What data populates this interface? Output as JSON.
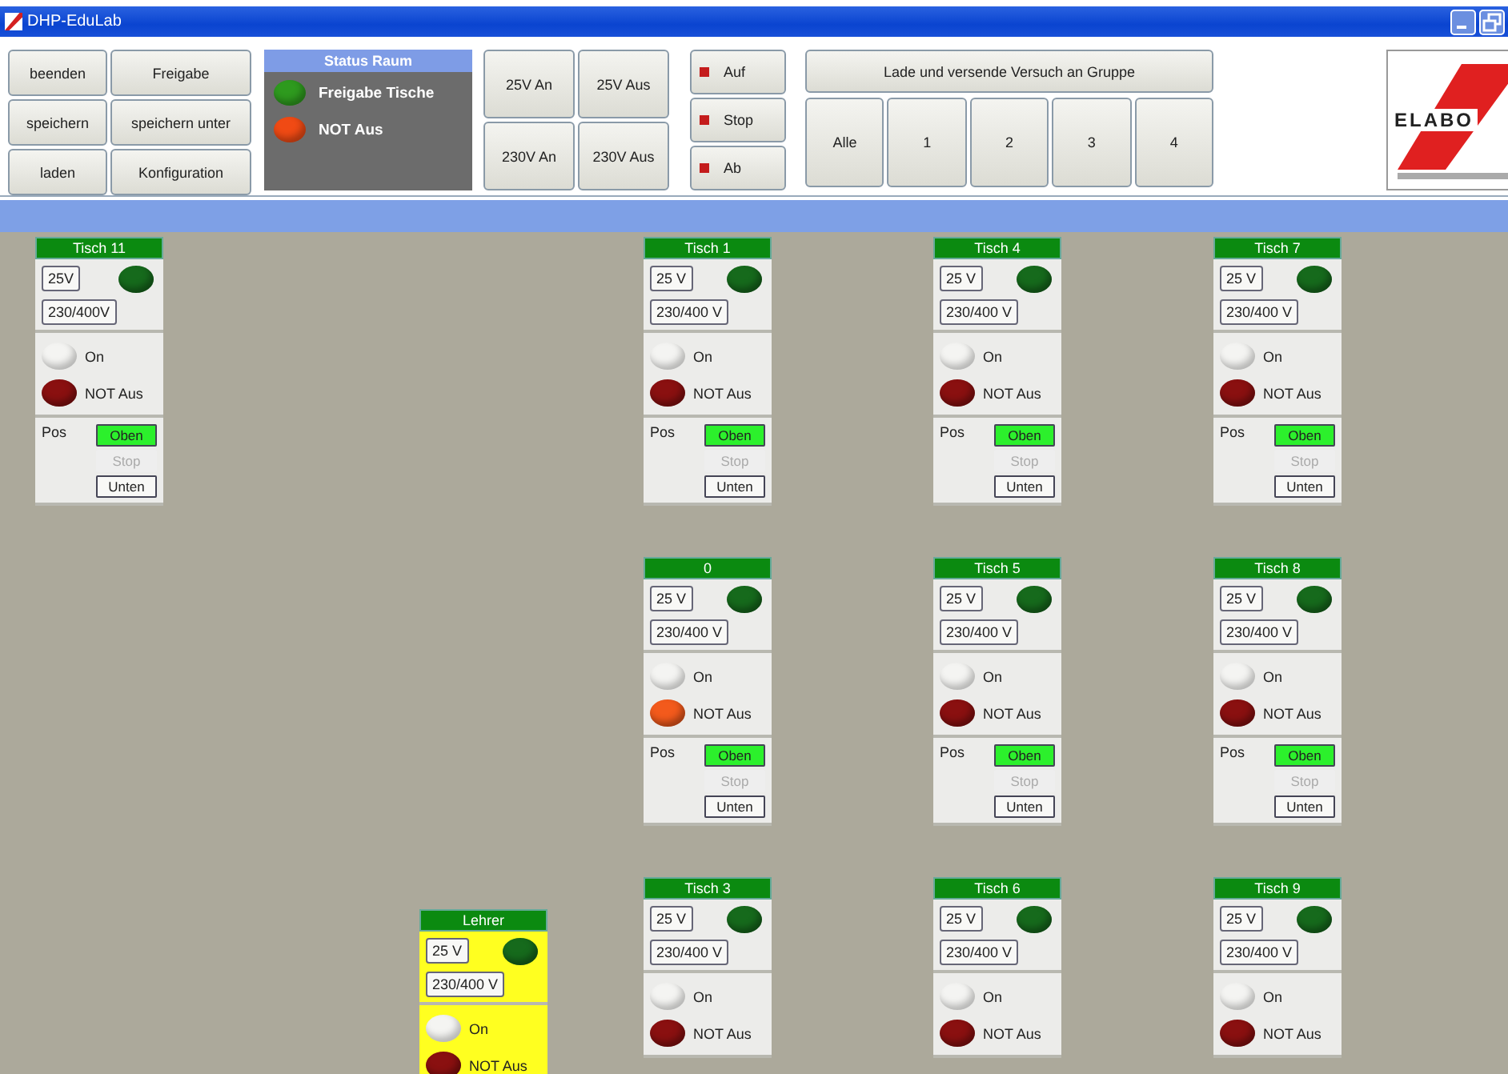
{
  "window": {
    "title": "DHP-EduLab"
  },
  "toolbar": {
    "file_buttons": [
      "beenden",
      "Freigabe",
      "speichern",
      "speichern unter",
      "laden",
      "Konfiguration"
    ],
    "room_status": {
      "title": "Status Raum",
      "indicators": [
        {
          "label": "Freigabe Tische",
          "color": "#2e9a1e"
        },
        {
          "label": "NOT Aus",
          "color": "#f04a14"
        }
      ]
    },
    "voltage_buttons": [
      "25V An",
      "25V Aus",
      "230V An",
      "230V Aus"
    ],
    "motion_buttons": [
      "Auf",
      "Stop",
      "Ab"
    ],
    "group": {
      "title": "Lade und versende Versuch an Gruppe",
      "buttons": [
        "Alle",
        "1",
        "2",
        "3",
        "4"
      ]
    },
    "logo": {
      "text": "ELABO"
    }
  },
  "canvas": {
    "columns": [
      {
        "panels": [
          {
            "title": "Tisch 11",
            "teacher": false,
            "low_voltage": "25V",
            "mains_voltage": "230/400V",
            "lamps": [
              {
                "kind": "on",
                "label": "On",
                "lit": false
              },
              {
                "kind": "emergency",
                "label": "NOT Aus",
                "lit": false
              }
            ],
            "position": {
              "label": "Pos",
              "buttons": [
                {
                  "label": "Oben",
                  "selected": true,
                  "disabled": false
                },
                {
                  "label": "Stop",
                  "selected": false,
                  "disabled": true
                },
                {
                  "label": "Unten",
                  "selected": false,
                  "disabled": false
                }
              ]
            }
          }
        ]
      },
      {
        "panels": [
          {
            "title": "Lehrer",
            "teacher": true,
            "low_voltage": "25 V",
            "mains_voltage": "230/400 V",
            "lamps": [
              {
                "kind": "on",
                "label": "On",
                "lit": false
              },
              {
                "kind": "emergency",
                "label": "NOT Aus",
                "lit": false
              }
            ]
          }
        ]
      },
      {
        "panels": [
          {
            "title": "Tisch 1",
            "teacher": false,
            "low_voltage": "25 V",
            "mains_voltage": "230/400 V",
            "lamps": [
              {
                "kind": "on",
                "label": "On",
                "lit": false
              },
              {
                "kind": "emergency",
                "label": "NOT Aus",
                "lit": false
              }
            ],
            "position": {
              "label": "Pos",
              "buttons": [
                {
                  "label": "Oben",
                  "selected": true,
                  "disabled": false
                },
                {
                  "label": "Stop",
                  "selected": false,
                  "disabled": true
                },
                {
                  "label": "Unten",
                  "selected": false,
                  "disabled": false
                }
              ]
            }
          },
          {
            "title": "0",
            "teacher": false,
            "low_voltage": "25 V",
            "mains_voltage": "230/400 V",
            "lamps": [
              {
                "kind": "on",
                "label": "On",
                "lit": false
              },
              {
                "kind": "emergency",
                "label": "NOT Aus",
                "lit": true
              }
            ],
            "position": {
              "label": "Pos",
              "buttons": [
                {
                  "label": "Oben",
                  "selected": true,
                  "disabled": false
                },
                {
                  "label": "Stop",
                  "selected": false,
                  "disabled": true
                },
                {
                  "label": "Unten",
                  "selected": false,
                  "disabled": false
                }
              ]
            }
          },
          {
            "title": "Tisch 3",
            "teacher": false,
            "low_voltage": "25 V",
            "mains_voltage": "230/400 V",
            "lamps": [
              {
                "kind": "on",
                "label": "On",
                "lit": false
              },
              {
                "kind": "emergency",
                "label": "NOT Aus",
                "lit": false
              }
            ]
          }
        ]
      },
      {
        "panels": [
          {
            "title": "Tisch 4",
            "teacher": false,
            "low_voltage": "25 V",
            "mains_voltage": "230/400 V",
            "lamps": [
              {
                "kind": "on",
                "label": "On",
                "lit": false
              },
              {
                "kind": "emergency",
                "label": "NOT Aus",
                "lit": false
              }
            ],
            "position": {
              "label": "Pos",
              "buttons": [
                {
                  "label": "Oben",
                  "selected": true,
                  "disabled": false
                },
                {
                  "label": "Stop",
                  "selected": false,
                  "disabled": true
                },
                {
                  "label": "Unten",
                  "selected": false,
                  "disabled": false
                }
              ]
            }
          },
          {
            "title": "Tisch 5",
            "teacher": false,
            "low_voltage": "25 V",
            "mains_voltage": "230/400 V",
            "lamps": [
              {
                "kind": "on",
                "label": "On",
                "lit": false
              },
              {
                "kind": "emergency",
                "label": "NOT Aus",
                "lit": false
              }
            ],
            "position": {
              "label": "Pos",
              "buttons": [
                {
                  "label": "Oben",
                  "selected": true,
                  "disabled": false
                },
                {
                  "label": "Stop",
                  "selected": false,
                  "disabled": true
                },
                {
                  "label": "Unten",
                  "selected": false,
                  "disabled": false
                }
              ]
            }
          },
          {
            "title": "Tisch 6",
            "teacher": false,
            "low_voltage": "25 V",
            "mains_voltage": "230/400 V",
            "lamps": [
              {
                "kind": "on",
                "label": "On",
                "lit": false
              },
              {
                "kind": "emergency",
                "label": "NOT Aus",
                "lit": false
              }
            ]
          }
        ]
      },
      {
        "panels": [
          {
            "title": "Tisch 7",
            "teacher": false,
            "low_voltage": "25 V",
            "mains_voltage": "230/400 V",
            "lamps": [
              {
                "kind": "on",
                "label": "On",
                "lit": false
              },
              {
                "kind": "emergency",
                "label": "NOT Aus",
                "lit": false
              }
            ],
            "position": {
              "label": "Pos",
              "buttons": [
                {
                  "label": "Oben",
                  "selected": true,
                  "disabled": false
                },
                {
                  "label": "Stop",
                  "selected": false,
                  "disabled": true
                },
                {
                  "label": "Unten",
                  "selected": false,
                  "disabled": false
                }
              ]
            }
          },
          {
            "title": "Tisch 8",
            "teacher": false,
            "low_voltage": "25 V",
            "mains_voltage": "230/400 V",
            "lamps": [
              {
                "kind": "on",
                "label": "On",
                "lit": false
              },
              {
                "kind": "emergency",
                "label": "NOT Aus",
                "lit": false
              }
            ],
            "position": {
              "label": "Pos",
              "buttons": [
                {
                  "label": "Oben",
                  "selected": true,
                  "disabled": false
                },
                {
                  "label": "Stop",
                  "selected": false,
                  "disabled": true
                },
                {
                  "label": "Unten",
                  "selected": false,
                  "disabled": false
                }
              ]
            }
          },
          {
            "title": "Tisch 9",
            "teacher": false,
            "low_voltage": "25 V",
            "mains_voltage": "230/400 V",
            "lamps": [
              {
                "kind": "on",
                "label": "On",
                "lit": false
              },
              {
                "kind": "emergency",
                "label": "NOT Aus",
                "lit": false
              }
            ]
          }
        ]
      }
    ]
  }
}
